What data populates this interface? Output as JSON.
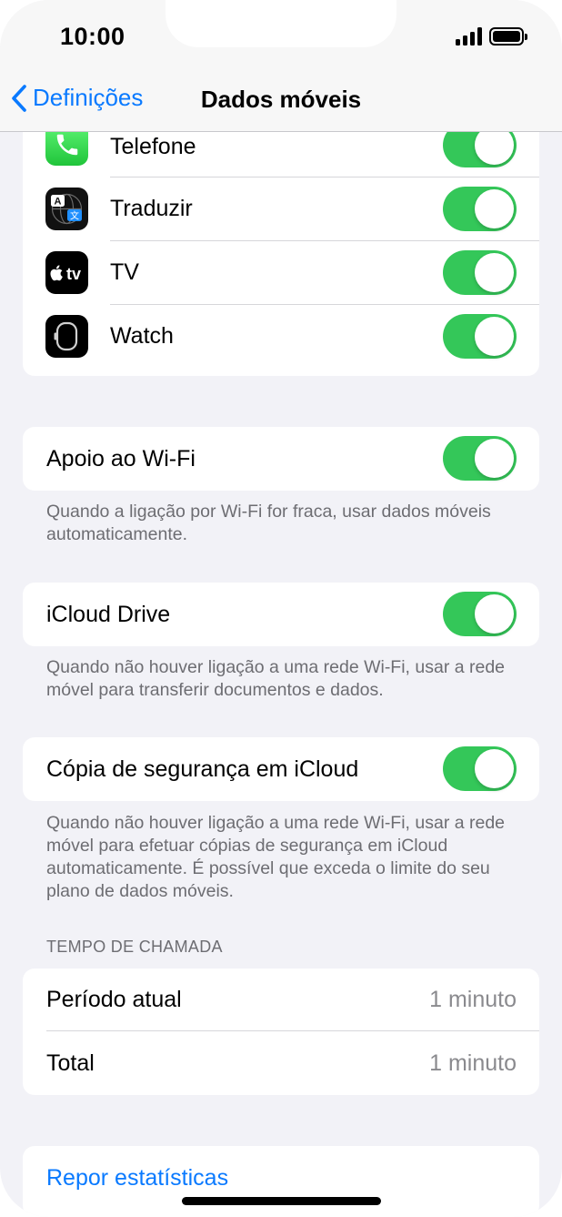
{
  "status_bar": {
    "time": "10:00"
  },
  "nav": {
    "back_label": "Definições",
    "title": "Dados móveis"
  },
  "apps": [
    {
      "name": "Telefone",
      "icon": "phone-icon",
      "enabled": true
    },
    {
      "name": "Traduzir",
      "icon": "translate-icon",
      "enabled": true
    },
    {
      "name": "TV",
      "icon": "apple-tv-icon",
      "enabled": true
    },
    {
      "name": "Watch",
      "icon": "watch-icon",
      "enabled": true
    }
  ],
  "apple_tv_text": "tv",
  "translate_icon_text": {
    "a": "A",
    "b": "文"
  },
  "wifi_assist": {
    "label": "Apoio ao Wi-Fi",
    "enabled": true,
    "footnote": "Quando a ligação por Wi-Fi for fraca, usar dados móveis automaticamente."
  },
  "icloud_drive": {
    "label": "iCloud Drive",
    "enabled": true,
    "footnote": "Quando não houver ligação a uma rede Wi-Fi, usar a rede móvel para transferir documentos e dados."
  },
  "icloud_backup": {
    "label": "Cópia de segurança em iCloud",
    "enabled": true,
    "footnote": "Quando não houver ligação a uma rede Wi-Fi, usar a rede móvel para efetuar cópias de segurança em iCloud automaticamente. É possível que exceda o limite do seu plano de dados móveis."
  },
  "call_time": {
    "header": "TEMPO DE CHAMADA",
    "current_label": "Período atual",
    "current_value": "1 minuto",
    "total_label": "Total",
    "total_value": "1 minuto"
  },
  "reset": {
    "label": "Repor estatísticas"
  },
  "colors": {
    "accent": "#0a7aff",
    "toggle_on": "#34c759",
    "background": "#f2f2f7"
  }
}
